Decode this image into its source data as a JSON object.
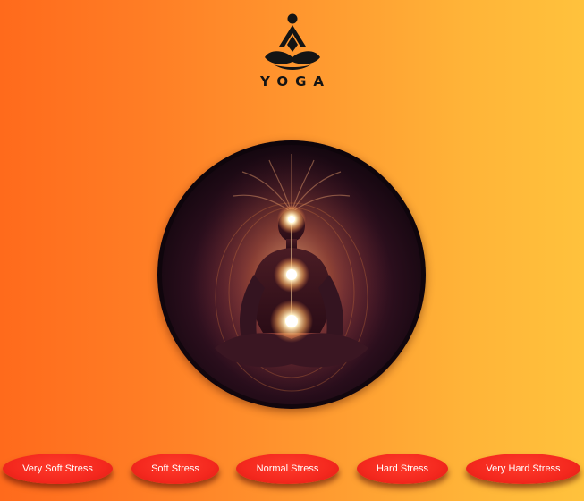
{
  "logo": {
    "icon": "meditating-figure-icon",
    "wordmark": "YOGA"
  },
  "illustration": {
    "icon": "meditating-chakra-figure",
    "colors": {
      "dark": "#1a0a14",
      "glow": "#ffe6b0",
      "aura": "#c8602e"
    }
  },
  "stress_buttons": [
    {
      "label": "Very Soft Stress"
    },
    {
      "label": "Soft Stress"
    },
    {
      "label": "Normal Stress"
    },
    {
      "label": "Hard Stress"
    },
    {
      "label": "Very Hard Stress"
    }
  ],
  "colors": {
    "background_start": "#ff6a1c",
    "background_end": "#ffc23c",
    "button": "#f4281e",
    "button_text": "#ffffff",
    "logo": "#141414"
  }
}
